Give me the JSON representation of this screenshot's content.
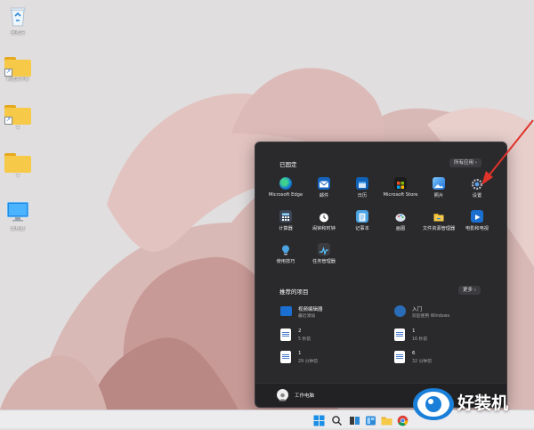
{
  "desktop": {
    "icons": [
      {
        "label": "回收站"
      },
      {
        "label": "新建文件夹"
      },
      {
        "label": "2"
      },
      {
        "label": "1"
      },
      {
        "label": "此电脑"
      }
    ]
  },
  "start_menu": {
    "pinned_title": "已固定",
    "all_apps_label": "所有应用",
    "pinned_apps": [
      {
        "label": "Microsoft Edge",
        "icon": "edge-icon"
      },
      {
        "label": "邮件",
        "icon": "mail-icon"
      },
      {
        "label": "日历",
        "icon": "calendar-icon"
      },
      {
        "label": "Microsoft Store",
        "icon": "store-icon"
      },
      {
        "label": "照片",
        "icon": "photos-icon"
      },
      {
        "label": "设置",
        "icon": "settings-gear-icon"
      },
      {
        "label": "计算器",
        "icon": "calculator-icon"
      },
      {
        "label": "闹钟和时钟",
        "icon": "alarm-clock-icon"
      },
      {
        "label": "记事本",
        "icon": "notepad-icon"
      },
      {
        "label": "画图",
        "icon": "paint-icon"
      },
      {
        "label": "文件资源管理器",
        "icon": "file-explorer-icon"
      },
      {
        "label": "电影和电视",
        "icon": "movies-tv-icon"
      },
      {
        "label": "使用技巧",
        "icon": "tips-icon"
      },
      {
        "label": "任务管理器",
        "icon": "task-manager-icon"
      }
    ],
    "recommended_title": "推荐的项目",
    "more_label": "更多",
    "recommended": [
      {
        "title": "视频编辑器",
        "subtitle": "最近添加"
      },
      {
        "title": "入门",
        "subtitle": "欢迎使用 Windows"
      },
      {
        "title": "2",
        "subtitle": "5 秒前"
      },
      {
        "title": "1",
        "subtitle": "16 秒前"
      },
      {
        "title": "1",
        "subtitle": "29 分钟前"
      },
      {
        "title": "6",
        "subtitle": "32 分钟前"
      }
    ],
    "user_name": "工作电脑"
  },
  "watermark": {
    "text": "好装机"
  },
  "colors": {
    "menu_bg": "#2a2a2c",
    "accent_red": "#e0332a",
    "taskbar": "#ecebee"
  }
}
